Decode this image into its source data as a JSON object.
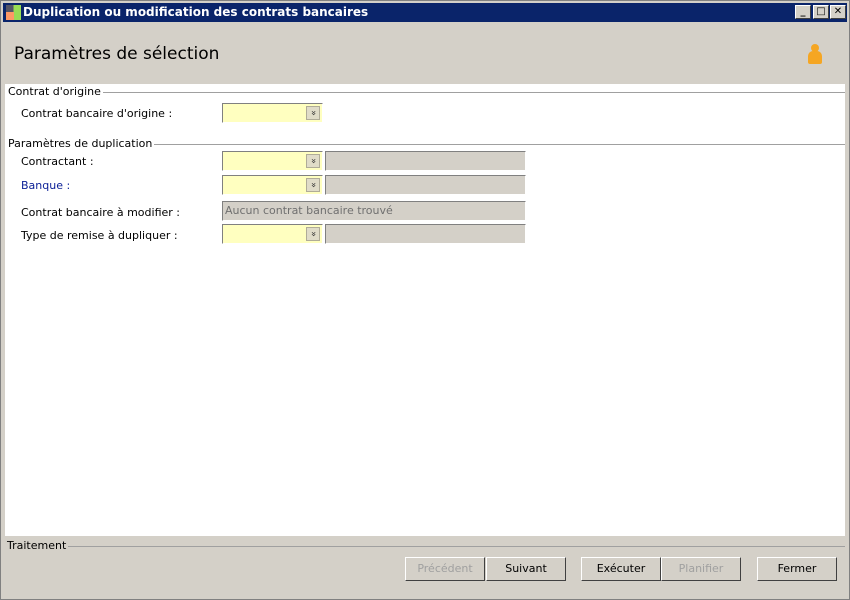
{
  "window": {
    "title": "Duplication ou modification des contrats bancaires",
    "buttons": [
      "_",
      "□",
      "✕"
    ]
  },
  "header": {
    "title": "Paramètres de sélection",
    "icon": "person-icon"
  },
  "groups": {
    "origin": {
      "label": "Contrat d'origine",
      "field": "Contrat bancaire d'origine :"
    },
    "dup": {
      "label": "Paramètres de duplication",
      "contractant": "Contractant :",
      "banque": "Banque :",
      "contrat_modifier": "Contrat bancaire à modifier :",
      "contrat_modifier_value": "Aucun contrat bancaire trouvé",
      "type_remise": "Type de remise à dupliquer :"
    }
  },
  "combo_arrow": "»",
  "footer": {
    "label": "Traitement",
    "buttons": {
      "prev": "Précédent",
      "next": "Suivant",
      "exec": "Exécuter",
      "plan": "Planifier",
      "close": "Fermer"
    }
  }
}
